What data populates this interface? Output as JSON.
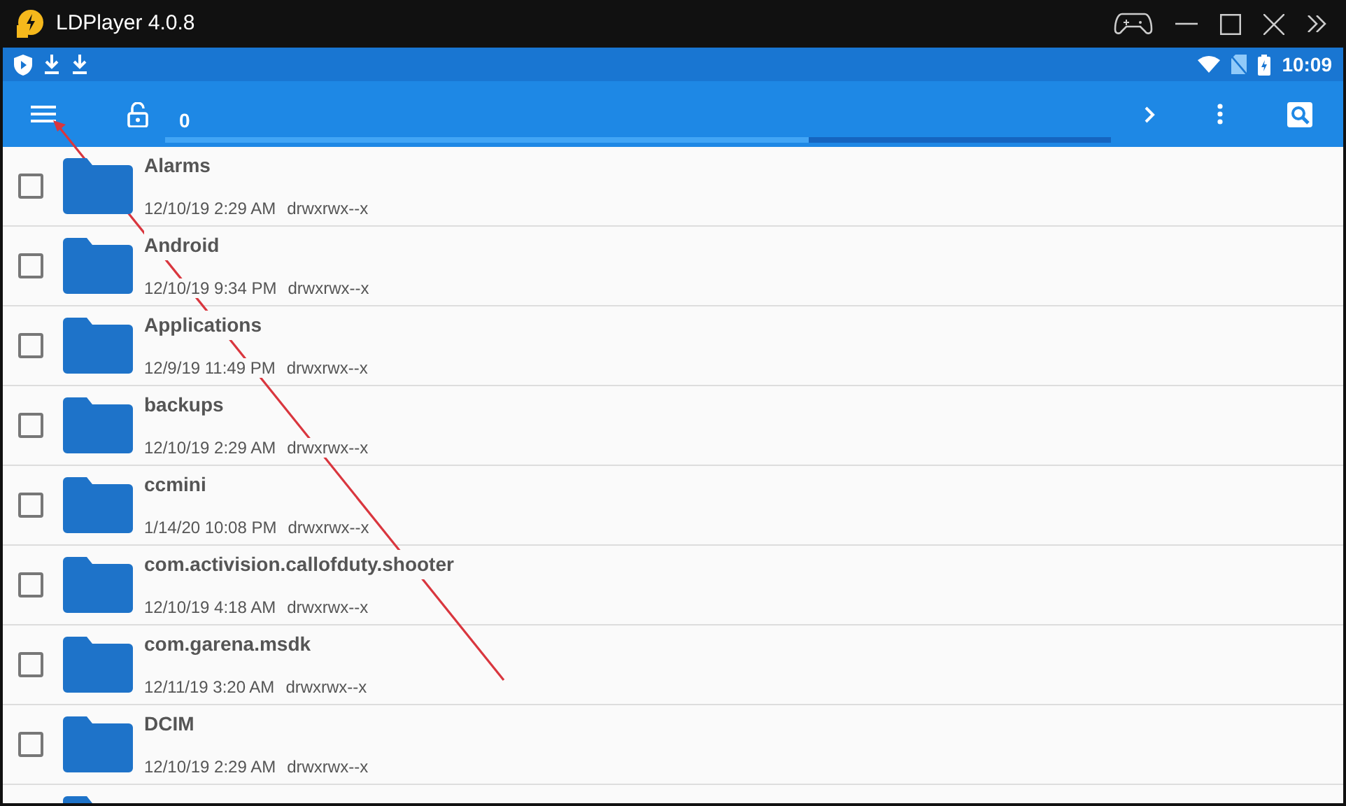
{
  "window": {
    "title": "LDPlayer 4.0.8"
  },
  "status_bar": {
    "time": "10:09"
  },
  "toolbar": {
    "path": "0"
  },
  "files": [
    {
      "name": "Alarms",
      "date": "12/10/19 2:29 AM",
      "permissions": "drwxrwx--x",
      "checked": false
    },
    {
      "name": "Android",
      "date": "12/10/19 9:34 PM",
      "permissions": "drwxrwx--x",
      "checked": false
    },
    {
      "name": "Applications",
      "date": "12/9/19 11:49 PM",
      "permissions": "drwxrwx--x",
      "checked": false
    },
    {
      "name": "backups",
      "date": "12/10/19 2:29 AM",
      "permissions": "drwxrwx--x",
      "checked": false
    },
    {
      "name": "ccmini",
      "date": "1/14/20 10:08 PM",
      "permissions": "drwxrwx--x",
      "checked": false
    },
    {
      "name": "com.activision.callofduty.shooter",
      "date": "12/10/19 4:18 AM",
      "permissions": "drwxrwx--x",
      "checked": false
    },
    {
      "name": "com.garena.msdk",
      "date": "12/11/19 3:20 AM",
      "permissions": "drwxrwx--x",
      "checked": false
    },
    {
      "name": "DCIM",
      "date": "12/10/19 2:29 AM",
      "permissions": "drwxrwx--x",
      "checked": false
    }
  ]
}
